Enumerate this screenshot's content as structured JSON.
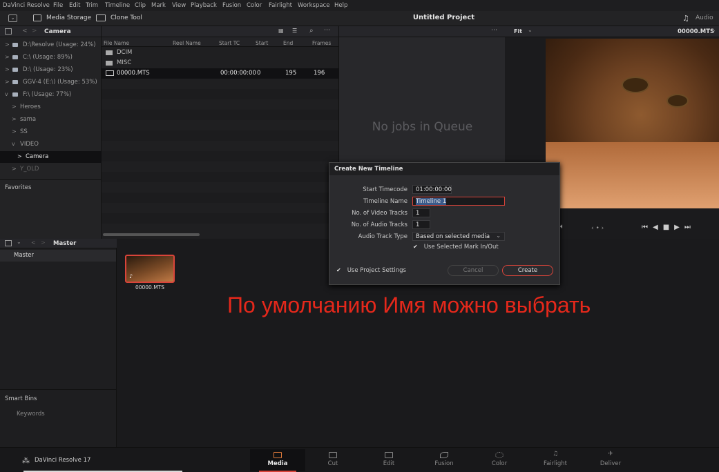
{
  "menubar": [
    "DaVinci Resolve",
    "File",
    "Edit",
    "Trim",
    "Timeline",
    "Clip",
    "Mark",
    "View",
    "Playback",
    "Fusion",
    "Color",
    "Fairlight",
    "Workspace",
    "Help"
  ],
  "toolbar": {
    "media_storage": "Media Storage",
    "clone_tool": "Clone Tool",
    "project_title": "Untitled Project",
    "audio": "Audio"
  },
  "storage": {
    "path": "Camera",
    "items": [
      {
        "label": "D:\\Resolve (Usage: 24%)",
        "arrow": ">"
      },
      {
        "label": "C:\\ (Usage: 89%)",
        "arrow": ">"
      },
      {
        "label": "D:\\ (Usage: 23%)",
        "arrow": ">"
      },
      {
        "label": "GGV-4 (E:\\) (Usage: 53%)",
        "arrow": ">"
      },
      {
        "label": "F:\\ (Usage: 77%)",
        "arrow": "v"
      }
    ],
    "folders": [
      {
        "label": "Heroes",
        "arrow": ">"
      },
      {
        "label": "sama",
        "arrow": ">"
      },
      {
        "label": "SS",
        "arrow": ">"
      },
      {
        "label": "VIDEO",
        "arrow": "v"
      },
      {
        "label": "Camera",
        "arrow": ">"
      },
      {
        "label": "Y_OLD",
        "arrow": ">"
      }
    ],
    "favorites": "Favorites"
  },
  "medialist": {
    "columns": [
      "File Name",
      "Reel Name",
      "Start TC",
      "Start",
      "End",
      "Frames"
    ],
    "rows": [
      {
        "name": "DCIM",
        "start_tc": "",
        "start": "",
        "end": "",
        "frames": ""
      },
      {
        "name": "MISC",
        "start_tc": "",
        "start": "",
        "end": "",
        "frames": ""
      },
      {
        "name": "00000.MTS",
        "start_tc": "00:00:00:00",
        "start": "0",
        "end": "195",
        "frames": "196"
      }
    ]
  },
  "queue": {
    "empty": "No jobs in Queue"
  },
  "viewer": {
    "fit": "Fit",
    "clip": "00000.MTS"
  },
  "bins": {
    "master_header": "Master",
    "master": "Master",
    "smart_bins": "Smart Bins",
    "keywords": "Keywords"
  },
  "pool": {
    "clip_name": "00000.MTS"
  },
  "dialog": {
    "title": "Create New Timeline",
    "start_timecode_label": "Start Timecode",
    "start_timecode": "01:00:00:00",
    "timeline_name_label": "Timeline Name",
    "timeline_name": "Timeline 1",
    "video_tracks_label": "No. of Video Tracks",
    "video_tracks": "1",
    "audio_tracks_label": "No. of Audio Tracks",
    "audio_tracks": "1",
    "audio_type_label": "Audio Track Type",
    "audio_type": "Based on selected media",
    "mark_label": "Use Selected Mark In/Out",
    "project_settings_label": "Use Project Settings",
    "cancel": "Cancel",
    "create": "Create"
  },
  "annotation": "По умолчанию Имя можно выбрать",
  "app_name": "DaVinci Resolve 17",
  "pages": [
    "Media",
    "Cut",
    "Edit",
    "Fusion",
    "Color",
    "Fairlight",
    "Deliver"
  ],
  "active_page": "Media",
  "colors": {
    "accent_red": "#e5281b",
    "selected_outline": "#d9443a"
  }
}
